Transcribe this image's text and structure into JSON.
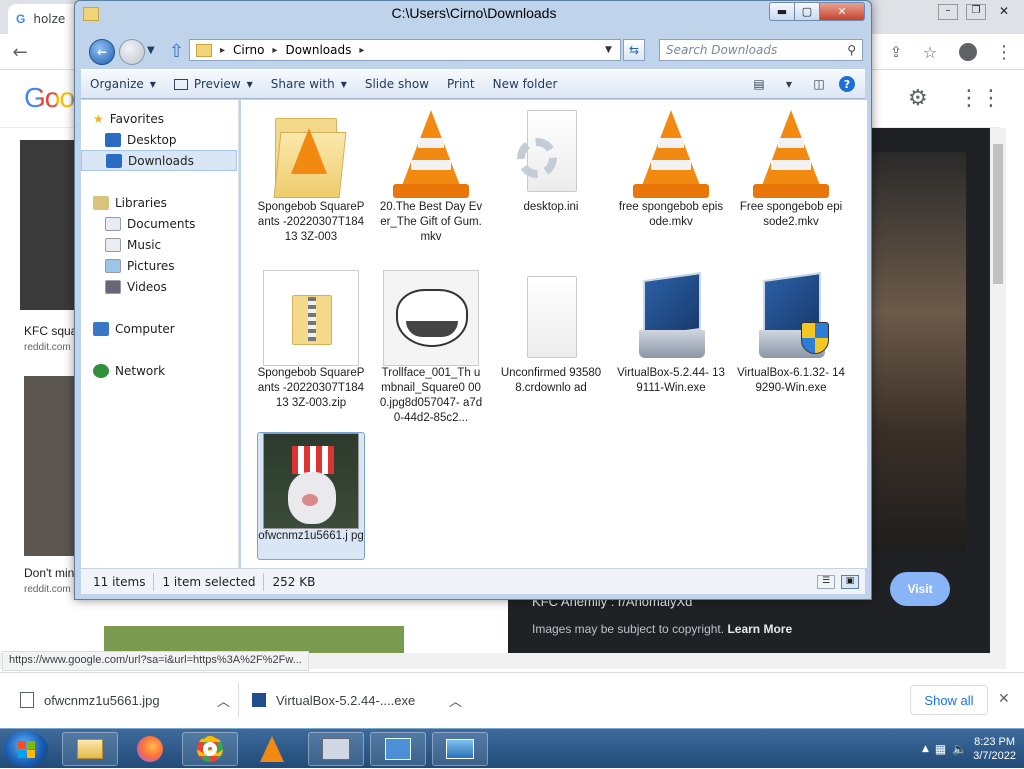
{
  "browser": {
    "tabs": [
      {
        "label": "holze",
        "favicon": "google-g"
      },
      {
        "label": "",
        "favicon": "blank"
      },
      {
        "label": "",
        "favicon": "blank"
      }
    ],
    "toolbar": {
      "back": "←",
      "share_icon": "share-icon",
      "bookmark_icon": "star-icon",
      "profile_icon": "profile-icon"
    },
    "google_logo": "Goog",
    "results": [
      {
        "title": "KFC squa",
        "source": "reddit.com"
      },
      {
        "title": "Don't min",
        "source": "reddit.com"
      }
    ],
    "preview": {
      "title": "KFC Anemily : r/AnomalyXd",
      "copyright_text": "Images may be subject to copyright.",
      "learn_more": "Learn More",
      "visit_label": "Visit"
    },
    "status_url": "https://www.google.com/url?sa=i&url=https%3A%2F%2Fw...",
    "downloads": [
      {
        "name": "ofwcnmz1u5661.jpg"
      },
      {
        "name": "VirtualBox-5.2.44-....exe"
      }
    ],
    "show_all_label": "Show all"
  },
  "explorer": {
    "title": "C:\\Users\\Cirno\\Downloads",
    "address": {
      "segments": [
        "Cirno",
        "Downloads"
      ]
    },
    "search_placeholder": "Search Downloads",
    "toolbar": {
      "organize": "Organize",
      "preview": "Preview",
      "share_with": "Share with",
      "slide_show": "Slide show",
      "print": "Print",
      "new_folder": "New folder"
    },
    "nav": {
      "favorites": "Favorites",
      "desktop": "Desktop",
      "downloads": "Downloads",
      "libraries": "Libraries",
      "documents": "Documents",
      "music": "Music",
      "pictures": "Pictures",
      "videos": "Videos",
      "computer": "Computer",
      "network": "Network"
    },
    "files": [
      {
        "name": "Spongebob SquarePants -20220307T18413 3Z-003",
        "type": "folder"
      },
      {
        "name": "20.The Best Day Ever_The Gift of Gum.mkv",
        "type": "vlc"
      },
      {
        "name": "desktop.ini",
        "type": "ini"
      },
      {
        "name": "free spongebob episode.mkv",
        "type": "vlc"
      },
      {
        "name": "Free spongebob episode2.mkv",
        "type": "vlc"
      },
      {
        "name": "Spongebob SquarePants -20220307T18413 3Z-003.zip",
        "type": "zip"
      },
      {
        "name": "Trollface_001_Th umbnail_Square0 000.jpg8d057047- a7d0-44d2-85c2...",
        "type": "image"
      },
      {
        "name": "Unconfirmed 935808.crdownlo ad",
        "type": "blank"
      },
      {
        "name": "VirtualBox-5.2.44- 139111-Win.exe",
        "type": "virtualbox"
      },
      {
        "name": "VirtualBox-6.1.32- 149290-Win.exe",
        "type": "virtualbox-admin"
      },
      {
        "name": "ofwcnmz1u5661.j pg",
        "type": "photo"
      }
    ],
    "status": {
      "items": "11 items",
      "selected": "1 item selected",
      "size": "252 KB"
    }
  },
  "taskbar": {
    "clock_time": "8:23 PM",
    "clock_date": "3/7/2022",
    "apps": [
      "explorer",
      "firefox",
      "chrome",
      "vlc",
      "task-manager",
      "control-panel",
      "photo-viewer"
    ]
  }
}
